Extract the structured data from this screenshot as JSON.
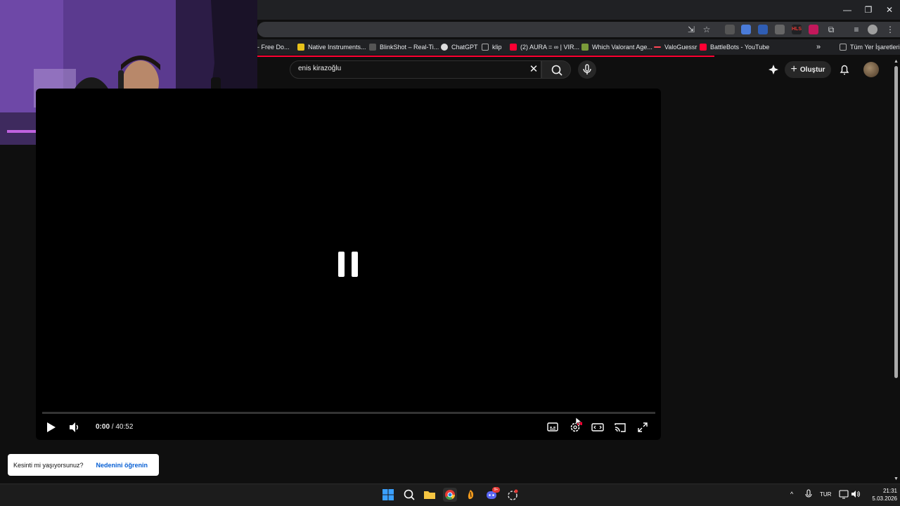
{
  "browser": {
    "bookmarks": [
      {
        "label": "- Free Do...",
        "color": "#333"
      },
      {
        "label": "Native Instruments...",
        "color": "#e8c21a"
      },
      {
        "label": "BlinkShot – Real-Ti...",
        "color": "#444"
      },
      {
        "label": "ChatGPT",
        "color": "#ddd"
      },
      {
        "label": "klip",
        "color": "#888"
      },
      {
        "label": "(2) AURA = ∞ | VIR...",
        "color": "#ff0033"
      },
      {
        "label": "Which Valorant Age...",
        "color": "#7a9a3a"
      },
      {
        "label": "ValoGuessr",
        "color": "#ff4655"
      },
      {
        "label": "BattleBots - YouTube",
        "color": "#ff0033"
      }
    ],
    "all_bookmarks_label": "Tüm Yer İşaretleri",
    "more_bookmarks": "»"
  },
  "youtube": {
    "search_value": "enis kirazoğlu",
    "create_label": "Oluştur"
  },
  "player": {
    "time_current": "0:00",
    "time_total": "40:52",
    "progress": 0
  },
  "toast": {
    "message": "Kesinti mi yaşıyorsunuz?",
    "link": "Nedenini öğrenin"
  },
  "taskbar": {
    "language": "TUR",
    "time": "21:31",
    "date": "5.03.2026",
    "discord_badge": "9+"
  }
}
